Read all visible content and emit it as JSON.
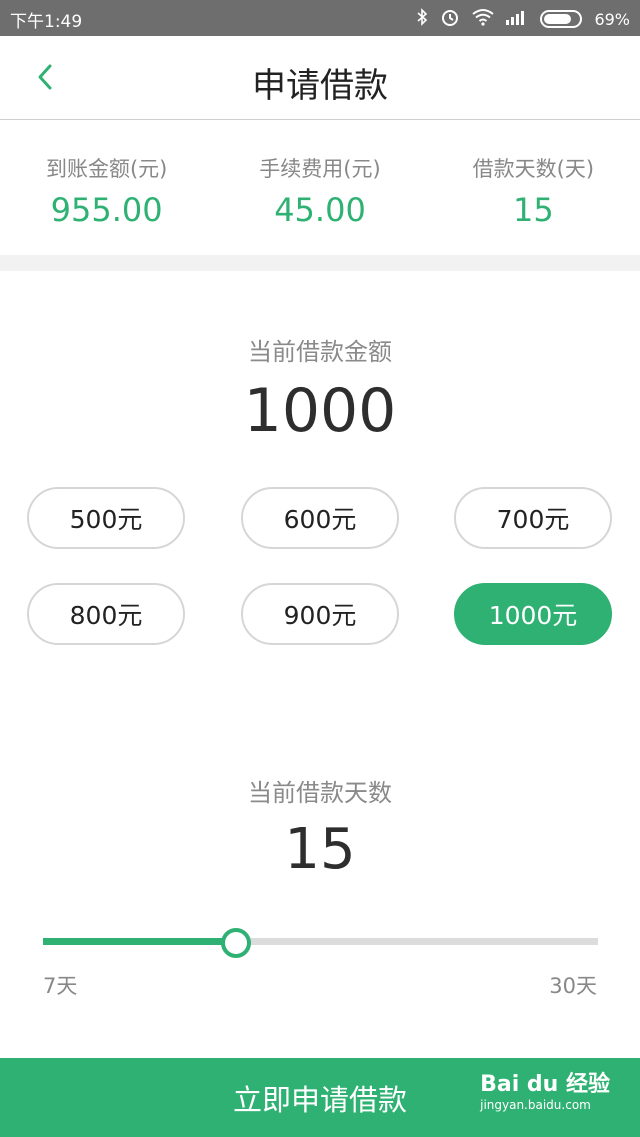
{
  "status_bar": {
    "time": "下午1:49",
    "battery": "69%",
    "battery_level": 0.69,
    "icons": [
      "bluetooth-icon",
      "alarm-icon",
      "wifi-icon",
      "signal-icon",
      "battery-icon"
    ]
  },
  "header": {
    "title": "申请借款",
    "back_icon": "chevron-left-icon"
  },
  "summary": [
    {
      "label": "到账金额(元)",
      "value": "955.00"
    },
    {
      "label": "手续费用(元)",
      "value": "45.00"
    },
    {
      "label": "借款天数(天)",
      "value": "15"
    }
  ],
  "amount": {
    "label": "当前借款金额",
    "value": "1000",
    "options": [
      "500元",
      "600元",
      "700元",
      "800元",
      "900元",
      "1000元"
    ],
    "selected_index": 5
  },
  "days": {
    "label": "当前借款天数",
    "value": "15",
    "min_label": "7天",
    "max_label": "30天",
    "min": 7,
    "max": 30,
    "current": 15
  },
  "submit_label": "立即申请借款",
  "watermark": {
    "main": "Bai du 经验",
    "sub": "jingyan.baidu.com"
  },
  "colors": {
    "accent": "#2fb173",
    "status_bar": "#6e6e6e"
  }
}
